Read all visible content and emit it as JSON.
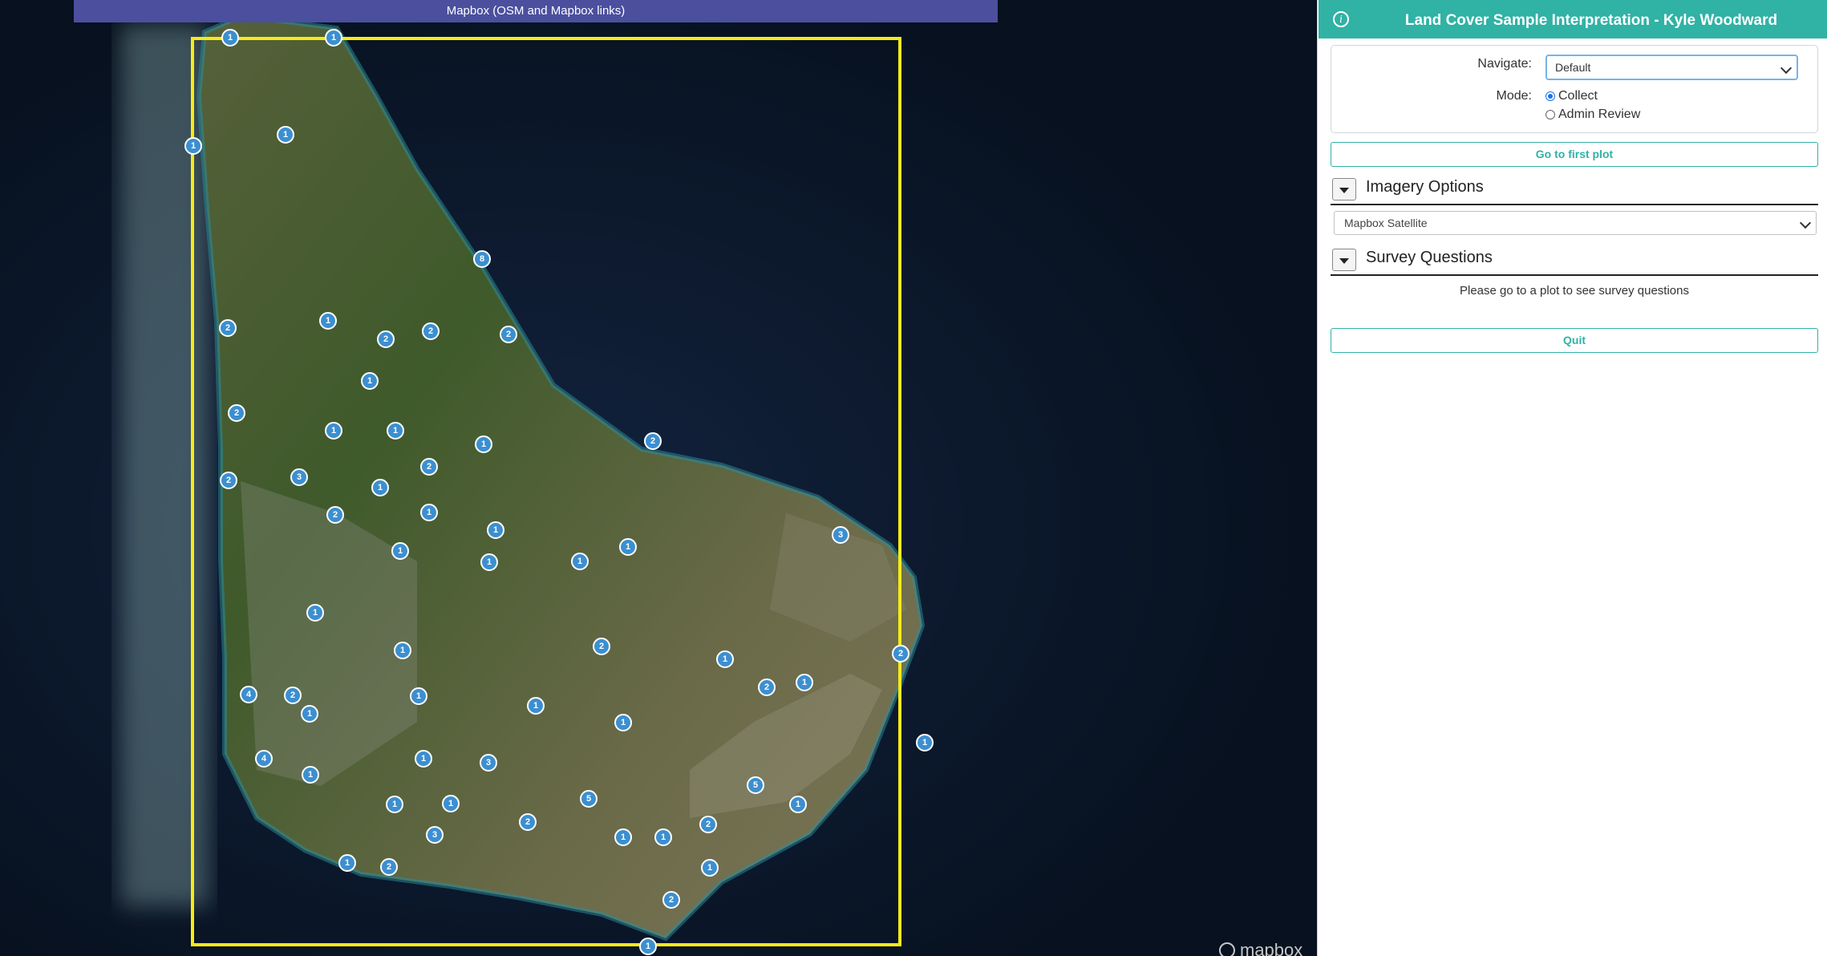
{
  "map": {
    "attribution": "Mapbox (OSM and Mapbox links)",
    "logo_text": "mapbox",
    "bbox_color": "#f5ea1a",
    "plot_color": "#3c8fd0",
    "plot_counts": [
      "1",
      "1",
      "1",
      "1",
      "8",
      "2",
      "1",
      "2",
      "2",
      "2",
      "1",
      "2",
      "1",
      "1",
      "1",
      "2",
      "2",
      "3",
      "2",
      "1",
      "2",
      "1",
      "1",
      "1",
      "1",
      "1",
      "1",
      "3",
      "1",
      "1",
      "2",
      "1",
      "4",
      "2",
      "1",
      "1",
      "1",
      "2",
      "2",
      "1",
      "1",
      "4",
      "1",
      "3",
      "1",
      "5",
      "1",
      "1",
      "1",
      "1",
      "3",
      "1",
      "1",
      "2",
      "2",
      "2",
      "1",
      "5",
      "1",
      "2",
      "1"
    ]
  },
  "panel": {
    "title": "Land Cover Sample Interpretation - Kyle Woodward",
    "info_icon": "i",
    "navigate_label": "Navigate:",
    "navigate_value": "Default",
    "mode_label": "Mode:",
    "mode_options": [
      "Collect",
      "Admin Review"
    ],
    "mode_selected": "Collect",
    "first_plot_button": "Go to first plot",
    "imagery_title": "Imagery Options",
    "imagery_value": "Mapbox Satellite",
    "survey_title": "Survey Questions",
    "survey_message": "Please go to a plot to see survey questions",
    "quit_button": "Quit",
    "accent_color": "#30b2a5"
  }
}
